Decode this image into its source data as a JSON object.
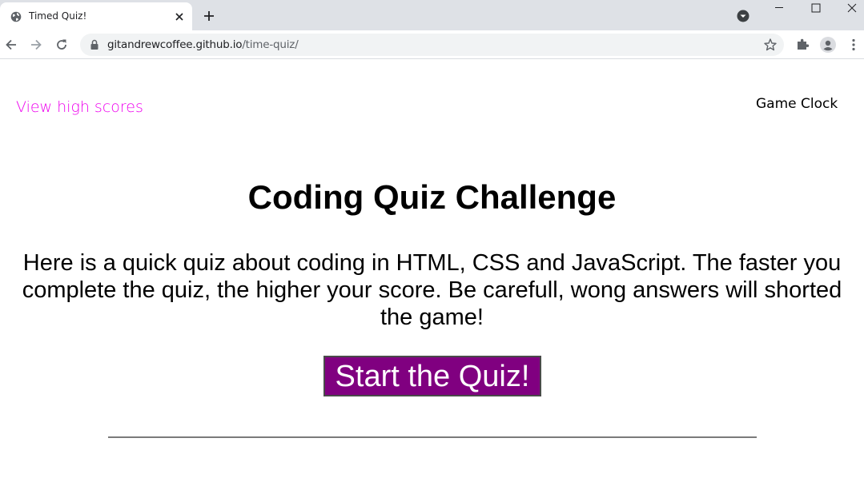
{
  "browser": {
    "tab_title": "Timed Quiz!",
    "url_host": "gitandrewcoffee.github.io",
    "url_path": "/time-quiz/",
    "icons": [
      "globe-icon",
      "close-icon",
      "plus-icon",
      "tab-search-icon",
      "minimize-icon",
      "maximize-icon",
      "window-close-icon",
      "back-arrow-icon",
      "forward-arrow-icon",
      "reload-icon",
      "lock-icon",
      "star-icon",
      "puzzle-icon",
      "profile-icon",
      "kebab-menu-icon"
    ]
  },
  "page": {
    "high_scores_link": "View high scores",
    "game_clock": "Game Clock",
    "title": "Coding Quiz Challenge",
    "intro": "Here is a quick quiz about coding in HTML, CSS and JavaScript. The faster you complete the quiz, the higher your score. Be carefull, wong answers will shorted the game!",
    "start_button": "Start the Quiz!"
  },
  "colors": {
    "link": "#ee00ee",
    "button_bg": "#800080",
    "button_text": "#ffffff"
  }
}
